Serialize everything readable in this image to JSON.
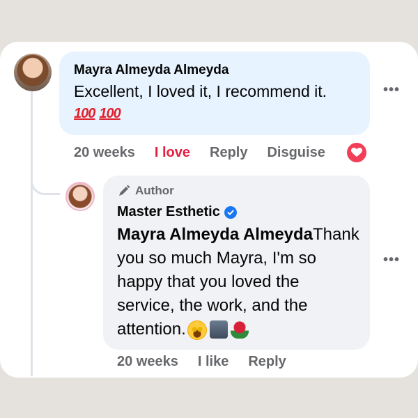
{
  "comment": {
    "author": "Mayra Almeyda Almeyda",
    "text": "Excellent, I loved it, I recommend it.",
    "emoji_100a": "100",
    "emoji_100b": "100",
    "time": "20 weeks",
    "love_label": "I love",
    "reply_label": "Reply",
    "disguise_label": "Disguise",
    "more_label": "•••"
  },
  "reply": {
    "author_tag": "Author",
    "page_name": "Master Esthetic",
    "mention": "Mayra Almeyda Almeyda",
    "text": "Thank you so much Mayra, I'm so happy that you loved the service, the work, and the attention.",
    "time": "20 weeks",
    "like_label": "I like",
    "reply_label": "Reply",
    "more_label": "•••"
  },
  "colors": {
    "bubble_blue": "#e7f3ff",
    "bubble_gray": "#f0f2f5",
    "love_red": "#e41e3f",
    "verified_blue": "#1877f2"
  },
  "icons": {
    "reaction": "heart-icon",
    "author": "pen-icon",
    "verified": "verified-badge-icon",
    "emojis": [
      "star-struck-emoji-icon",
      "camera-emoji-icon",
      "rose-emoji-icon"
    ]
  }
}
